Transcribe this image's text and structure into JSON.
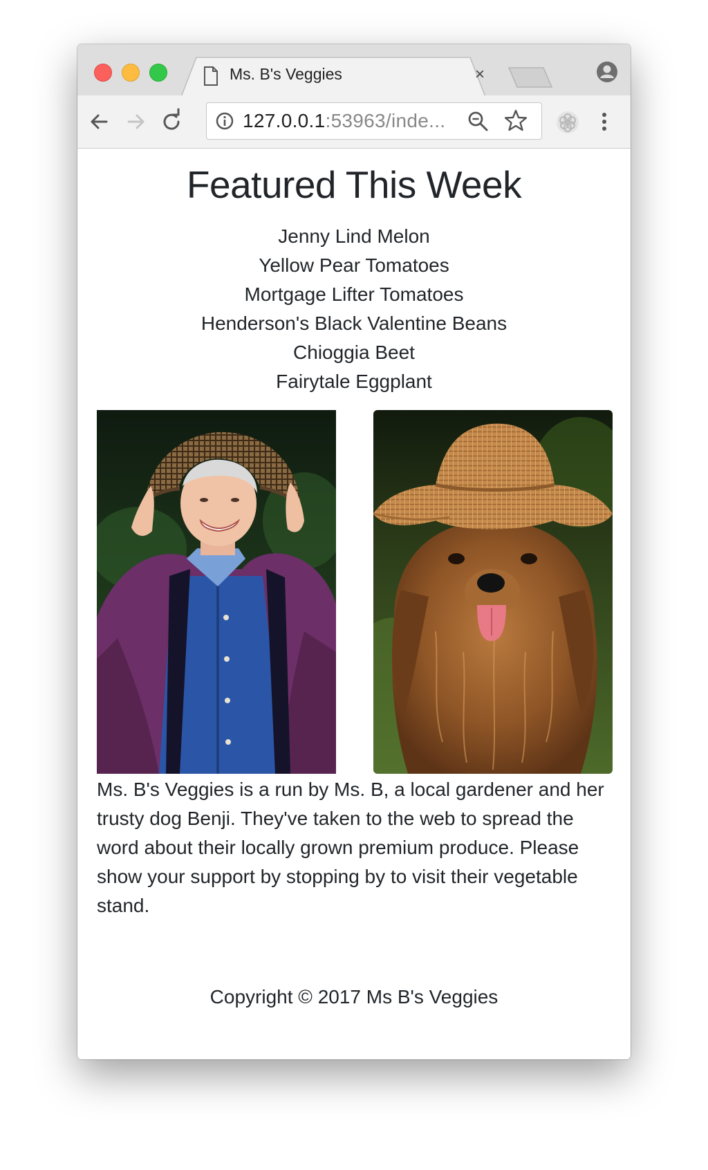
{
  "browser": {
    "tab_title": "Ms. B's Veggies",
    "tab_close": "×",
    "url_host": "127.0.0.1",
    "url_rest": ":53963/inde...",
    "icons": [
      "document-icon",
      "close-icon",
      "new-tab-icon",
      "profile-icon",
      "back-arrow-icon",
      "forward-arrow-icon",
      "reload-icon",
      "info-icon",
      "zoom-out-icon",
      "bookmark-star-icon",
      "extension-icon",
      "menu-dots-icon"
    ]
  },
  "page": {
    "title": "Featured This Week",
    "featured_items": [
      "Jenny Lind Melon",
      "Yellow Pear Tomatoes",
      "Mortgage Lifter Tomatoes",
      "Henderson's Black Valentine Beans",
      "Chioggia Beet",
      "Fairytale Eggplant"
    ],
    "description": "Ms. B's Veggies is a run by Ms. B, a local gardener and her trusty dog Benji. They've taken to the web to spread the word about their locally grown premium produce. Please show your support by stopping by to visit their vegetable stand.",
    "copyright": "Copyright © 2017 Ms B's Veggies"
  },
  "colors": {
    "text": "#212529",
    "tab_bar": "#dedede",
    "toolbar": "#f2f2f2"
  }
}
